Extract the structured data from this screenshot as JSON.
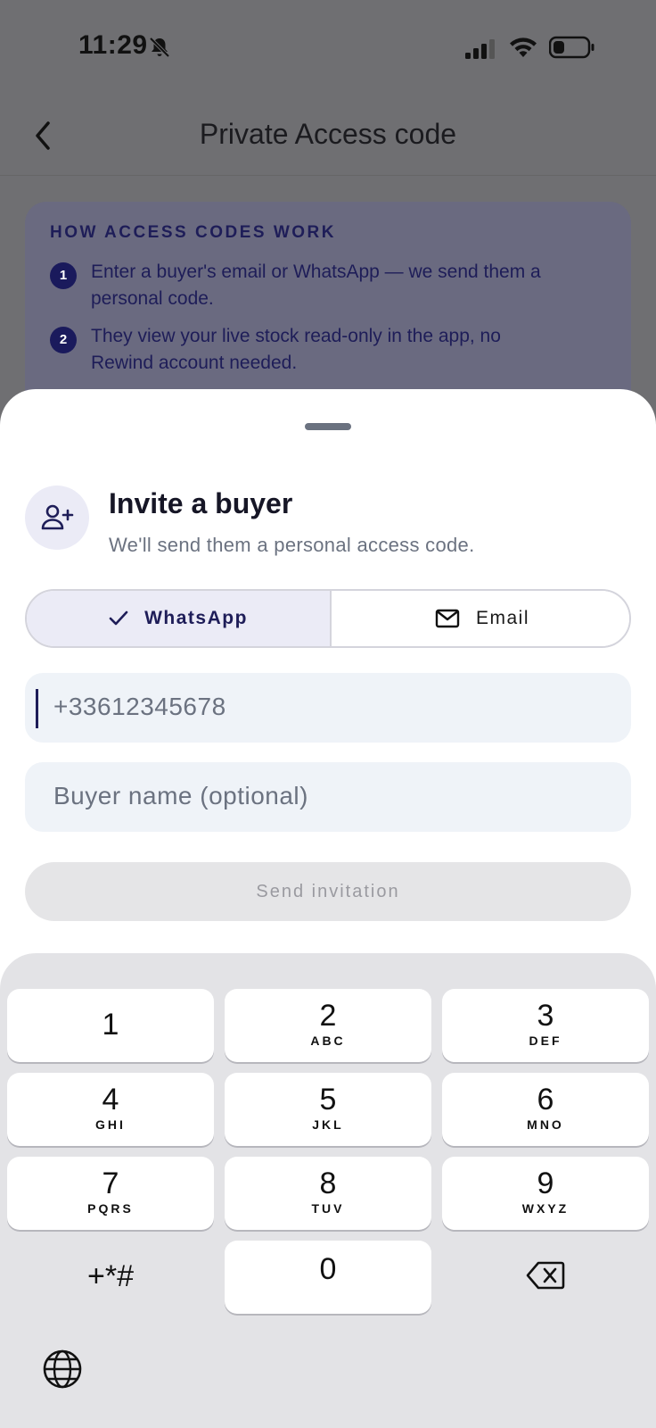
{
  "status_bar": {
    "time": "11:29"
  },
  "nav": {
    "title": "Private Access code"
  },
  "info": {
    "heading": "HOW ACCESS CODES WORK",
    "steps": [
      {
        "num": "1",
        "line1": "Enter a buyer's email or WhatsApp — we send them a",
        "line2": "personal code."
      },
      {
        "num": "2",
        "line1": "They view your live stock read-only in the app, no",
        "line2": "Rewind account needed."
      }
    ]
  },
  "sheet": {
    "title": "Invite a buyer",
    "subtitle": "We'll send them a personal access code.",
    "segments": [
      {
        "label": "WhatsApp",
        "icon": "check-icon",
        "selected": true
      },
      {
        "label": "Email",
        "icon": "mail-icon",
        "selected": false
      }
    ],
    "phone_value": "+33612345678",
    "name_placeholder": "Buyer name (optional)",
    "send_label": "Send invitation"
  },
  "keyboard": {
    "keys": [
      {
        "digit": "1",
        "letters": ""
      },
      {
        "digit": "2",
        "letters": "ABC"
      },
      {
        "digit": "3",
        "letters": "DEF"
      },
      {
        "digit": "4",
        "letters": "GHI"
      },
      {
        "digit": "5",
        "letters": "JKL"
      },
      {
        "digit": "6",
        "letters": "MNO"
      },
      {
        "digit": "7",
        "letters": "PQRS"
      },
      {
        "digit": "8",
        "letters": "TUV"
      },
      {
        "digit": "9",
        "letters": "WXYZ"
      },
      {
        "digit": "0",
        "letters": ""
      }
    ],
    "symbols": "+*#"
  },
  "colors": {
    "accent": "#1e1d58",
    "field_bg": "#eff3f8",
    "segment_active_bg": "#ebebf6"
  }
}
